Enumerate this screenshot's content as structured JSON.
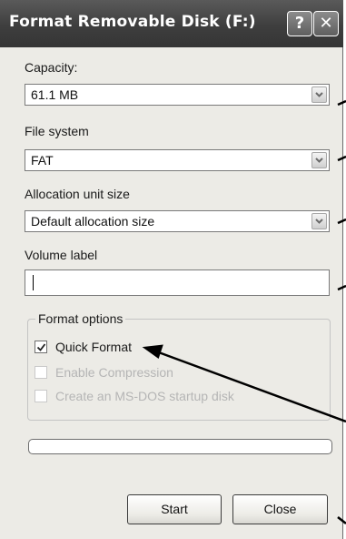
{
  "window": {
    "title": "Format Removable Disk (F:)",
    "help_glyph": "?",
    "close_glyph": "✕"
  },
  "capacity": {
    "label": "Capacity:",
    "value": "61.1 MB"
  },
  "file_system": {
    "label": "File system",
    "value": "FAT"
  },
  "allocation": {
    "label": "Allocation unit size",
    "value": "Default allocation size"
  },
  "volume": {
    "label": "Volume label",
    "value": ""
  },
  "format_options": {
    "title": "Format options",
    "quick_format": {
      "label": "Quick Format",
      "checked": true,
      "enabled": true
    },
    "enable_compression": {
      "label": "Enable Compression",
      "checked": false,
      "enabled": false
    },
    "ms_dos_startup": {
      "label": "Create an MS-DOS startup disk",
      "checked": false,
      "enabled": false
    }
  },
  "progress": {
    "fraction": 0
  },
  "buttons": {
    "start": "Start",
    "close": "Close"
  },
  "colors": {
    "titlebar": "#3e3e3e",
    "window_bg": "#ecebe6",
    "disabled_text": "#b5b5b5",
    "annotation_arrow": "#000000"
  },
  "icons": {
    "dropdown": "chevron-down-icon",
    "check": "checkmark-icon"
  }
}
